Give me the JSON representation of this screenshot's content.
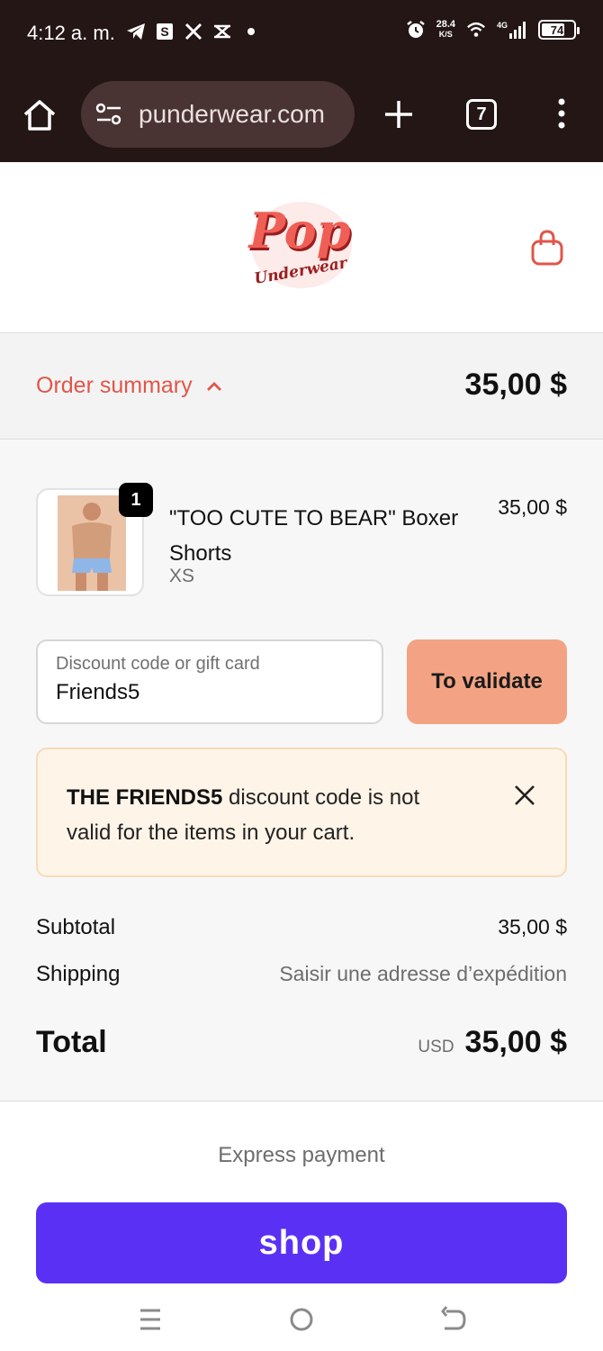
{
  "status_bar": {
    "time": "4:12 a. m.",
    "net_speed_value": "28.4",
    "net_speed_unit": "K/S",
    "network": "4G",
    "battery": "74",
    "battery_level": 0.74
  },
  "browser": {
    "url": "punderwear.com",
    "tab_count": "7"
  },
  "site": {
    "logo_text": "Pop Underwear"
  },
  "summary": {
    "label": "Order summary",
    "total": "35,00 $"
  },
  "product": {
    "quantity": "1",
    "name": "\"TOO CUTE TO BEAR\" Boxer Shorts",
    "variant": "XS",
    "price": "35,00 $"
  },
  "discount": {
    "placeholder": "Discount code or gift card",
    "value": "Friends5",
    "button_label": "To validate"
  },
  "alert": {
    "bold": "THE FRIENDS5",
    "text": " discount code is not valid for the items in your cart."
  },
  "totals": {
    "subtotal_label": "Subtotal",
    "subtotal_value": "35,00 $",
    "shipping_label": "Shipping",
    "shipping_value": "Saisir une adresse d’expédition",
    "total_label": "Total",
    "currency": "USD",
    "total_value": "35,00 $"
  },
  "express": {
    "title": "Express payment",
    "shop_label": "shop"
  },
  "colors": {
    "accent": "#e0564a",
    "validate_bg": "#f3a383",
    "shop_bg": "#5a31f4",
    "chrome_bg": "#231615"
  }
}
